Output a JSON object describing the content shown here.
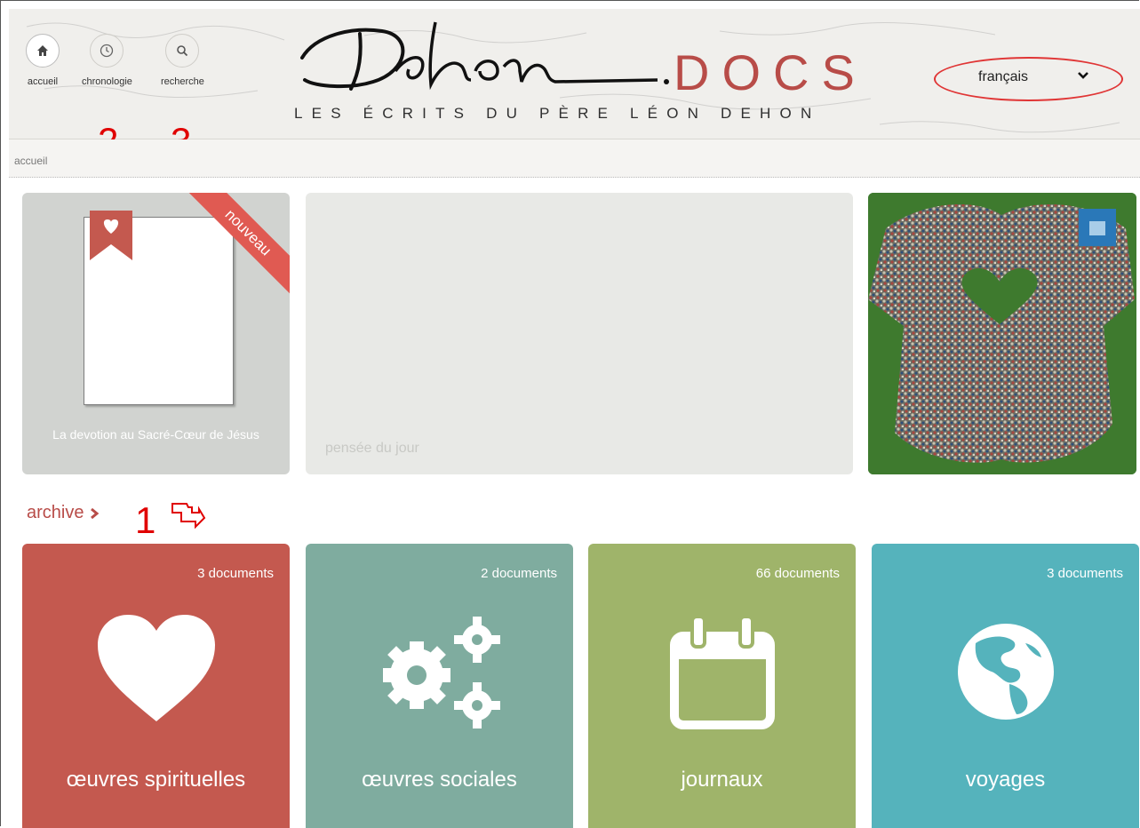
{
  "header": {
    "nav": [
      {
        "label": "accueil",
        "icon": "home-icon"
      },
      {
        "label": "chronologie",
        "icon": "clock-icon"
      },
      {
        "label": "recherche",
        "icon": "search-icon"
      }
    ],
    "logo_script": "Dehon",
    "logo_docs": "DOCS",
    "tagline": "LES ÉCRITS DU PÈRE LÉON DEHON",
    "language": "français"
  },
  "annotations": {
    "one": "1",
    "two": "2",
    "three": "3"
  },
  "breadcrumb": "accueil",
  "hero": {
    "new_badge": "nouveau",
    "new_title": "La devotion au Sacré-Cœur de Jésus",
    "thought_label": "pensée du jour"
  },
  "archive": {
    "label": "archive",
    "tiles": [
      {
        "count": "3 documents",
        "label": "œuvres spirituelles",
        "icon": "heart-icon",
        "color": "#c4594f"
      },
      {
        "count": "2 documents",
        "label": "œuvres sociales",
        "icon": "gears-icon",
        "color": "#7fac9f"
      },
      {
        "count": "66 documents",
        "label": "journaux",
        "icon": "calendar-icon",
        "color": "#9fb46a"
      },
      {
        "count": "3 documents",
        "label": "voyages",
        "icon": "globe-icon",
        "color": "#55b3bc"
      }
    ]
  },
  "colors": {
    "accent": "#b84c48",
    "annotation": "#e00000",
    "header_bg": "#f0efec"
  }
}
